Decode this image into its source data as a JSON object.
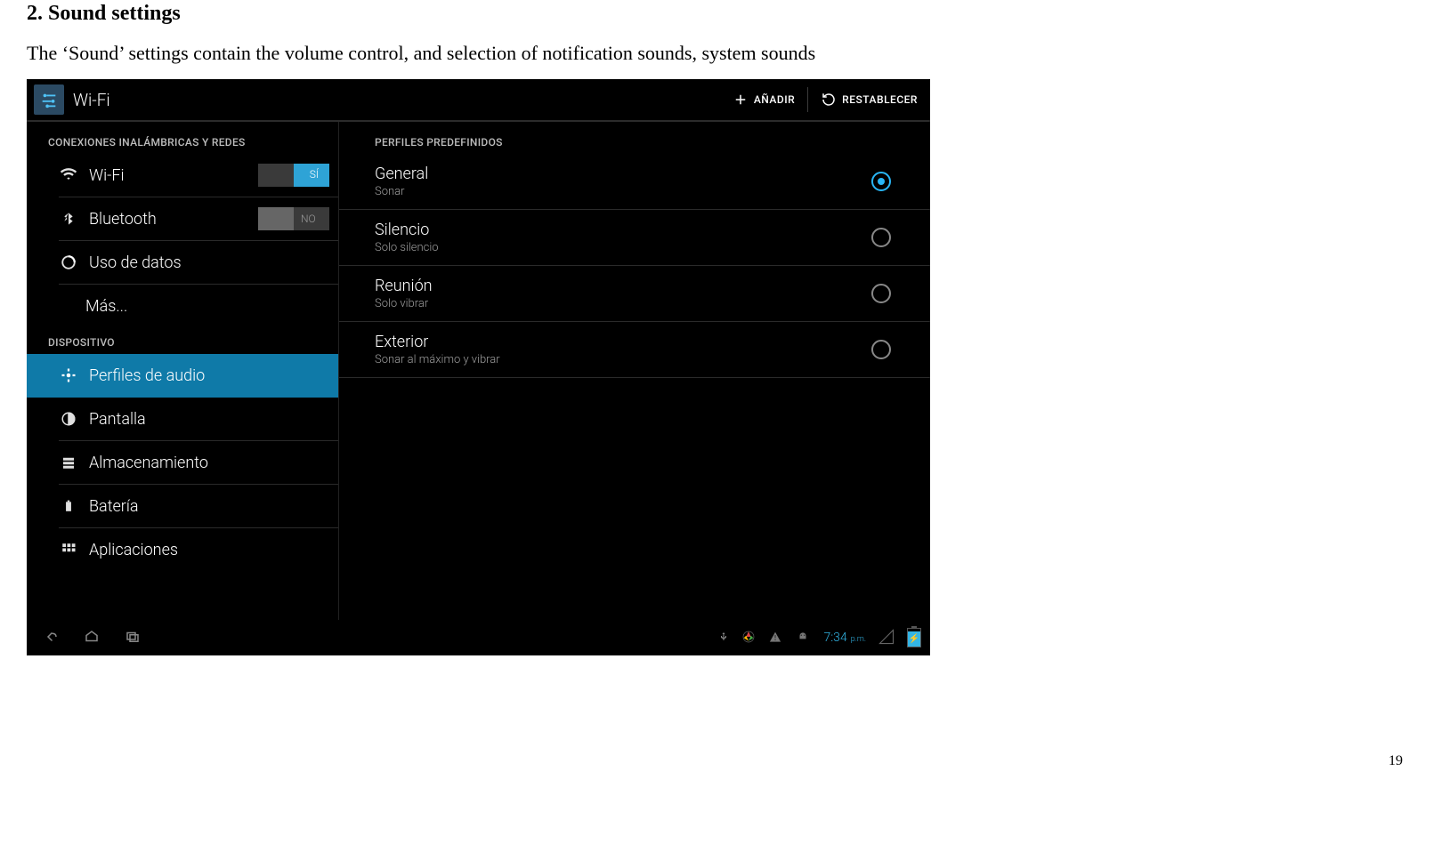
{
  "doc": {
    "heading": "2. Sound settings",
    "paragraph": "The ‘Sound’ settings contain the volume control, and selection of notification sounds, system sounds",
    "page_number": "19"
  },
  "header": {
    "title": "Wi-Fi",
    "add_label": "AÑADIR",
    "reset_label": "RESTABLECER"
  },
  "sidebar": {
    "group1_header": "CONEXIONES INALÁMBRICAS Y REDES",
    "wifi_label": "Wi-Fi",
    "wifi_toggle_state": "on",
    "wifi_toggle_text": "SÍ",
    "bluetooth_label": "Bluetooth",
    "bluetooth_toggle_state": "off",
    "bluetooth_toggle_text": "NO",
    "data_usage_label": "Uso de datos",
    "more_label": "Más...",
    "group2_header": "DISPOSITIVO",
    "audio_profiles_label": "Perfiles de audio",
    "display_label": "Pantalla",
    "storage_label": "Almacenamiento",
    "battery_label": "Batería",
    "apps_label": "Aplicaciones"
  },
  "content": {
    "header": "PERFILES PREDEFINIDOS",
    "profiles": [
      {
        "title": "General",
        "sub": "Sonar",
        "selected": true
      },
      {
        "title": "Silencio",
        "sub": "Solo silencio",
        "selected": false
      },
      {
        "title": "Reunión",
        "sub": "Solo vibrar",
        "selected": false
      },
      {
        "title": "Exterior",
        "sub": "Sonar al máximo y vibrar",
        "selected": false
      }
    ]
  },
  "statusbar": {
    "time": "7:34",
    "ampm": "p.m."
  }
}
